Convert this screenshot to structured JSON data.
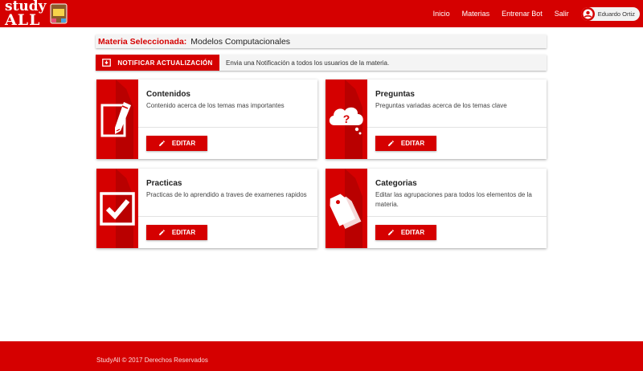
{
  "header": {
    "logo_line1": "study",
    "logo_line2": "ALL",
    "nav": [
      "Inicio",
      "Materias",
      "Entrenar Bot",
      "Salir"
    ],
    "user_name": "Eduardo Ortiz"
  },
  "subject": {
    "label": "Materia Seleccionada:",
    "value": "Modelos Computacionales"
  },
  "notify": {
    "button_label": "NOTIFICAR ACTUALIZACIÓN",
    "description": "Envia una Notificación a todos los usuarios de la materia."
  },
  "cards": [
    {
      "title": "Contenidos",
      "description": "Contenido acerca de los temas mas importantes",
      "button_label": "EDITAR",
      "icon": "document-pencil-icon"
    },
    {
      "title": "Preguntas",
      "description": "Preguntas variadas acerca de los temas clave",
      "button_label": "EDITAR",
      "icon": "question-cloud-icon"
    },
    {
      "title": "Practicas",
      "description": "Practicas de lo aprendido a traves de examenes rapidos",
      "button_label": "EDITAR",
      "icon": "checkbox-icon"
    },
    {
      "title": "Categorias",
      "description": "Editar las agrupaciones para todos los elementos de la materia.",
      "button_label": "EDITAR",
      "icon": "tags-icon"
    }
  ],
  "footer": {
    "text": "StudyAll © 2017 Derechos Reservados"
  },
  "colors": {
    "primary": "#d50000",
    "background": "#ffffff",
    "bar_background": "#f4f4f4"
  }
}
